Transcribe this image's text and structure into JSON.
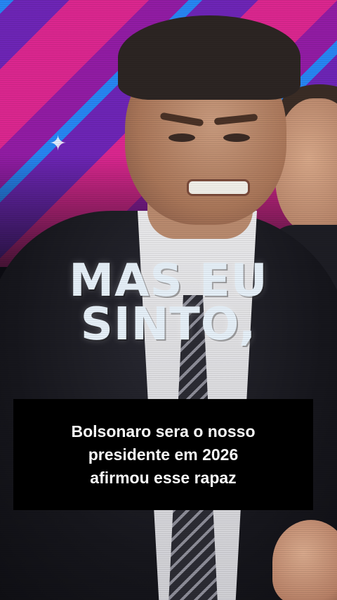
{
  "overlay": {
    "line1": "MAS EU",
    "line2": "SINTO,"
  },
  "caption": {
    "line1": "Bolsonaro sera o nosso",
    "line2": "presidente em 2026",
    "line3": "afirmou esse rapaz"
  },
  "colors": {
    "background_pink": "#e62896",
    "background_blue": "#288cff",
    "background_purple": "#7828c8",
    "caption_box": "#000000",
    "caption_text": "#ffffff",
    "overlay_text": "#e6f0f8"
  },
  "icons": [
    "star-icon"
  ]
}
